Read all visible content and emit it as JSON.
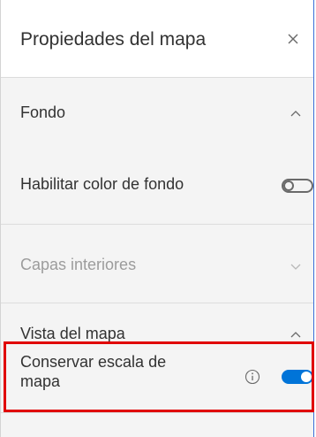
{
  "panel": {
    "title": "Propiedades del mapa",
    "close_icon": "close-icon"
  },
  "sections": {
    "fondo": {
      "label": "Fondo",
      "expanded": true,
      "chevron_icon": "chevron-up-icon",
      "background_color_label": "Habilitar color de fondo",
      "background_color_enabled": false
    },
    "capas": {
      "label": "Capas interiores",
      "disabled": true,
      "chevron_icon": "chevron-down-icon"
    },
    "vista": {
      "label": "Vista del mapa",
      "expanded": true,
      "chevron_icon": "chevron-up-icon",
      "preserve_scale_label_line1": "Conservar escala de",
      "preserve_scale_label_line2": "mapa",
      "info_icon": "info-icon",
      "preserve_scale_enabled": true
    }
  },
  "colors": {
    "accent": "#0074d8",
    "highlight": "#e00000",
    "disabled_text": "#9c9c9c"
  }
}
